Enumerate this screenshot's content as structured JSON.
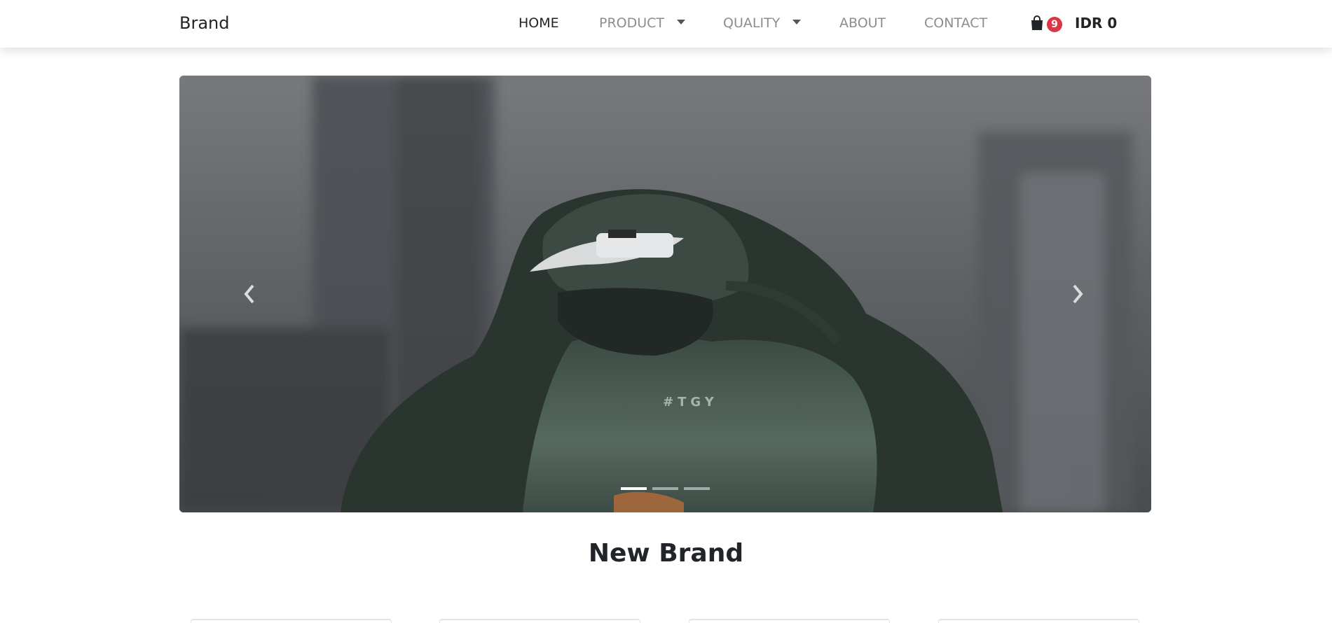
{
  "navbar": {
    "brand": "Brand",
    "links": [
      {
        "label": "HOME",
        "active": true
      },
      {
        "label": "PRODUCT",
        "dropdown": true
      },
      {
        "label": "QUALITY",
        "dropdown": true
      },
      {
        "label": "ABOUT"
      },
      {
        "label": "CONTACT"
      }
    ],
    "cart": {
      "icon": "shopping-bag-icon",
      "count": "9",
      "total": "IDR 0"
    },
    "colors": {
      "badge": "#dc3545",
      "link": "#8a8d91",
      "active": "#212529"
    }
  },
  "carousel": {
    "slide_count": 3,
    "active_index": 0,
    "slide_image": "person in green hooded jacket with cap and face mask, blurred city buildings behind",
    "slide_graphic_text": "#TGY",
    "prev_icon": "chevron-left-icon",
    "next_icon": "chevron-right-icon"
  },
  "section": {
    "title": "New Brand"
  }
}
